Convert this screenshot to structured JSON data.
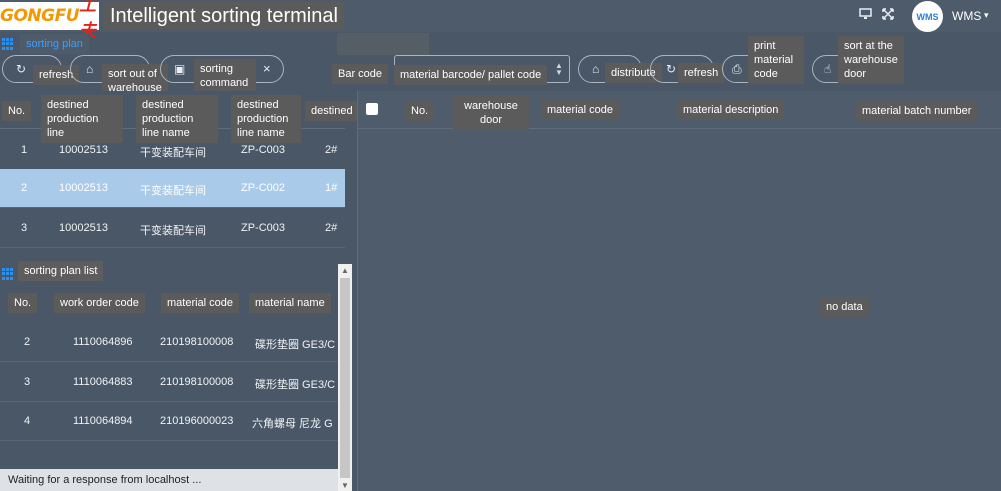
{
  "header": {
    "logo_text": "GONGFU",
    "logo_cn": "工夫",
    "title": "Intelligent sorting terminal",
    "monitor_icon": "monitor-icon",
    "fullscreen_icon": "fullscreen-icon",
    "avatar_text": "WMS",
    "user_name": "WMS",
    "caret": "▾"
  },
  "colors": {
    "accent": "#2e8ee8",
    "link": "#3aa0ff",
    "selected_row": "#a9cbe9",
    "background": "#4a5766",
    "logo_orange": "#f39800",
    "logo_red": "#e2231a"
  },
  "plan_section": {
    "label": "sorting plan"
  },
  "toolbar_left": {
    "refresh_label": "refresh",
    "sort_out_label": "sort out of warehouse",
    "command_label": "sorting command",
    "close_symbol": "×"
  },
  "toolbar_right": {
    "barcode_label": "Bar code",
    "barcode_placeholder": "material barcode/ pallet code",
    "distribute_label": "distribute",
    "refresh_label": "refresh",
    "print_label": "print material code",
    "sort_door_label": "sort at the warehouse door"
  },
  "plan_table": {
    "headers": [
      "No.",
      "destined production line",
      "destined production line name",
      "destined production line name",
      "destined"
    ],
    "rows": [
      [
        "1",
        "10002513",
        "干变装配车间",
        "ZP-C003",
        "2#"
      ],
      [
        "2",
        "10002513",
        "干变装配车间",
        "ZP-C002",
        "1#"
      ],
      [
        "3",
        "10002513",
        "干变装配车间",
        "ZP-C003",
        "2#"
      ]
    ]
  },
  "list_section": {
    "label": "sorting plan list"
  },
  "list_table": {
    "headers": [
      "No.",
      "work order code",
      "material code",
      "material name"
    ],
    "rows": [
      [
        "2",
        "1110064896",
        "210198100008",
        "碟形垫圈 GE3/C"
      ],
      [
        "3",
        "1110064883",
        "210198100008",
        "碟形垫圈 GE3/C"
      ],
      [
        "4",
        "1110064894",
        "210196000023",
        "六角螺母 尼龙 G"
      ]
    ]
  },
  "right_table": {
    "headers": [
      "No.",
      "warehouse door",
      "material code",
      "material description",
      "material batch number"
    ],
    "empty_text": "no data"
  },
  "status": {
    "text": "Waiting for a response from localhost ..."
  }
}
